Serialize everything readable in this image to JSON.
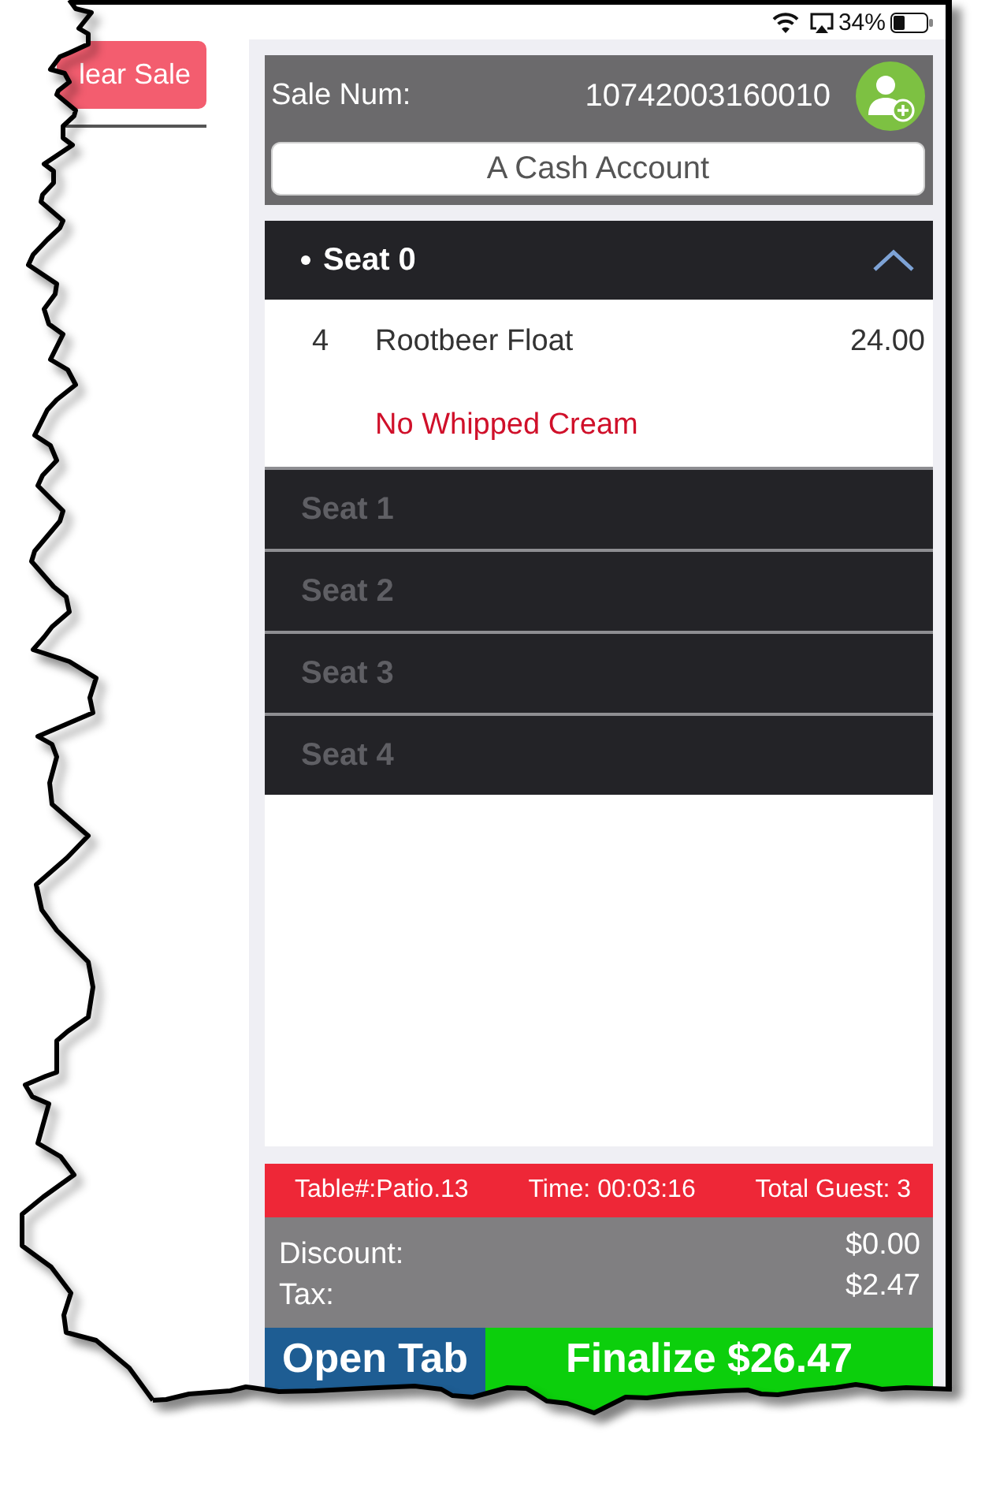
{
  "status_bar": {
    "battery": "34%"
  },
  "left_panel": {
    "clear_button": "lear Sale"
  },
  "sale": {
    "label": "Sale Num:",
    "number": "10742003160010",
    "account": {
      "value": "A Cash Account"
    }
  },
  "seats": [
    {
      "label": "Seat 0",
      "selected": true,
      "expanded": true,
      "items": [
        {
          "qty": "4",
          "name": "Rootbeer Float",
          "price": "24.00",
          "modifiers": [
            "No Whipped Cream"
          ]
        }
      ]
    },
    {
      "label": "Seat 1",
      "selected": false,
      "expanded": false
    },
    {
      "label": "Seat 2",
      "selected": false,
      "expanded": false
    },
    {
      "label": "Seat 3",
      "selected": false,
      "expanded": false
    },
    {
      "label": "Seat 4",
      "selected": false,
      "expanded": false
    }
  ],
  "info_bar": [
    "Table#:Patio.13",
    "Time: 00:03:16",
    "Total Guest: 3"
  ],
  "totals": [
    {
      "label": "Discount:",
      "value": "$0.00"
    },
    {
      "label": "Tax:",
      "value": "$2.47"
    }
  ],
  "buttons": [
    {
      "label": "Open Tab",
      "kind": "secondary"
    },
    {
      "label": "Finalize $26.47",
      "kind": "primary"
    }
  ]
}
